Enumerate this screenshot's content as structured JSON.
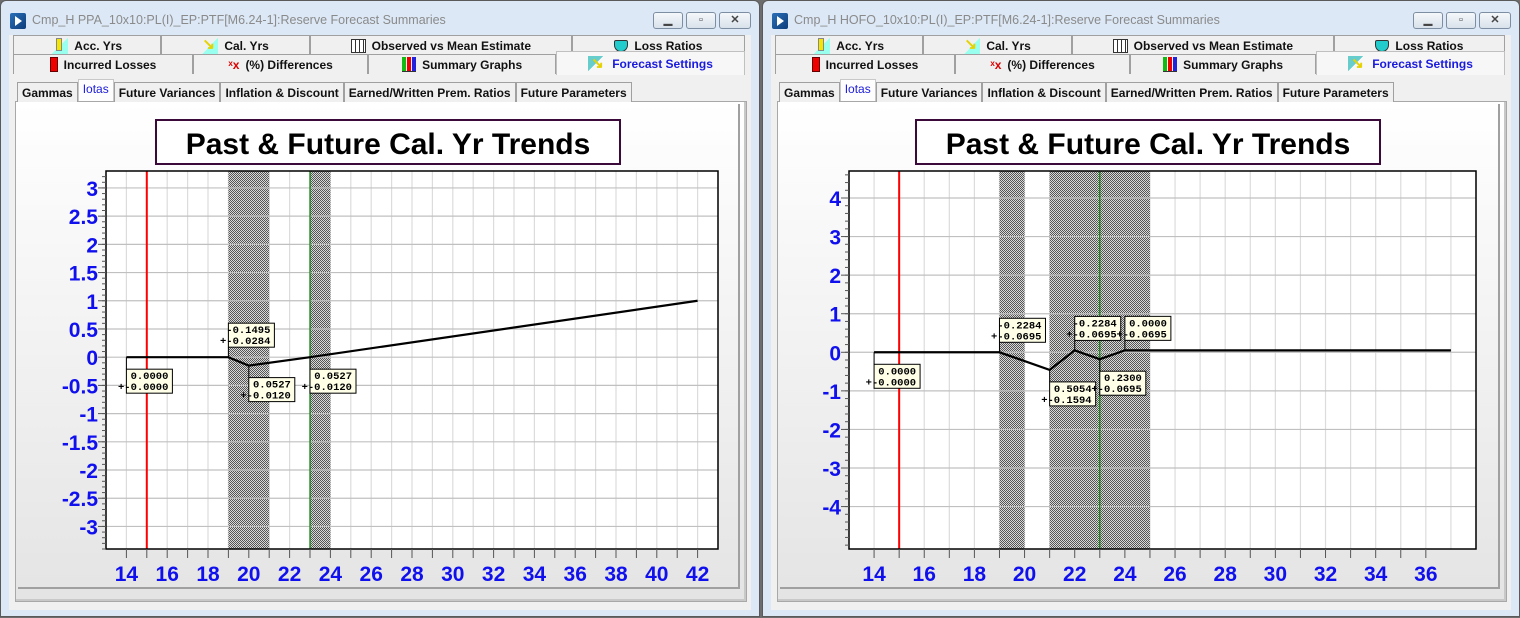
{
  "windows": [
    {
      "title": "Cmp_H PPA_10x10:PL(I)_EP:PTF[M6.24-1]:Reserve Forecast Summaries",
      "window_buttons": {
        "minimize": "minimize-icon",
        "restore": "restore-icon",
        "close": "close-icon"
      },
      "tabs_row1": [
        {
          "label": "Acc. Yrs",
          "icon": "acc-yrs-icon"
        },
        {
          "label": "Cal. Yrs",
          "icon": "cal-yrs-icon"
        },
        {
          "label": "Observed vs Mean Estimate",
          "icon": "table-icon"
        },
        {
          "label": "Loss Ratios",
          "icon": "gauge-icon"
        }
      ],
      "tabs_row2": [
        {
          "label": "Incurred Losses",
          "icon": "red-bar-icon"
        },
        {
          "label": "(%) Differences",
          "icon": "red-x-icon"
        },
        {
          "label": "Summary Graphs",
          "icon": "bar-chart-icon"
        },
        {
          "label": "Forecast Settings",
          "icon": "forecast-icon",
          "active": true
        }
      ],
      "subtabs": [
        {
          "label": "Gammas"
        },
        {
          "label": "Iotas",
          "active": true
        },
        {
          "label": "Future Variances"
        },
        {
          "label": "Inflation & Discount"
        },
        {
          "label": "Earned/Written Prem. Ratios"
        },
        {
          "label": "Future Parameters"
        }
      ],
      "accent_color": "#1a1adf"
    },
    {
      "title": "Cmp_H HOFO_10x10:PL(I)_EP:PTF[M6.24-1]:Reserve Forecast Summaries",
      "window_buttons": {
        "minimize": "minimize-icon",
        "restore": "restore-icon",
        "close": "close-icon"
      },
      "tabs_row1": [
        {
          "label": "Acc. Yrs",
          "icon": "acc-yrs-icon"
        },
        {
          "label": "Cal. Yrs",
          "icon": "cal-yrs-icon"
        },
        {
          "label": "Observed vs Mean Estimate",
          "icon": "table-icon"
        },
        {
          "label": "Loss Ratios",
          "icon": "gauge-icon"
        }
      ],
      "tabs_row2": [
        {
          "label": "Incurred Losses",
          "icon": "red-bar-icon"
        },
        {
          "label": "(%) Differences",
          "icon": "red-x-icon"
        },
        {
          "label": "Summary Graphs",
          "icon": "bar-chart-icon"
        },
        {
          "label": "Forecast Settings",
          "icon": "forecast-icon",
          "active": true
        }
      ],
      "subtabs": [
        {
          "label": "Gammas"
        },
        {
          "label": "Iotas",
          "active": true
        },
        {
          "label": "Future Variances"
        },
        {
          "label": "Inflation & Discount"
        },
        {
          "label": "Earned/Written Prem. Ratios"
        },
        {
          "label": "Future Parameters"
        }
      ],
      "accent_color": "#1a1adf"
    }
  ],
  "chart_data": [
    {
      "type": "line",
      "title": "Past & Future Cal. Yr Trends",
      "xlim": [
        13,
        43
      ],
      "ylim": [
        -3.4,
        3.3
      ],
      "x_ticks": [
        14,
        16,
        18,
        20,
        22,
        24,
        26,
        28,
        30,
        32,
        34,
        36,
        38,
        40,
        42
      ],
      "y_ticks": [
        3,
        2.5,
        2,
        1.5,
        1,
        0.5,
        0,
        -0.5,
        -1,
        -1.5,
        -2,
        -2.5,
        -3
      ],
      "y_tick_labels": [
        "3",
        "2.5",
        "2",
        "1.5",
        "1",
        "0.5",
        "0",
        "-0.5",
        "-1",
        "-1.5",
        "-2",
        "-2.5",
        "-3"
      ],
      "grid": true,
      "series": [
        {
          "name": "cal-yr-trend",
          "color": "#000000",
          "x": [
            14,
            19,
            20,
            23,
            42
          ],
          "y": [
            0,
            0,
            -0.1495,
            0,
            1.0
          ]
        }
      ],
      "vertical_lines": [
        {
          "x": 15,
          "color": "#ff0000"
        },
        {
          "x": 23,
          "color": "#008000"
        }
      ],
      "shaded_bands": [
        [
          19,
          21
        ],
        [
          23,
          24
        ]
      ],
      "annotations": [
        {
          "x": 14,
          "y": 0,
          "trend": "0.0000",
          "stderr": "+-0.0000",
          "position": "below"
        },
        {
          "x": 19,
          "y": 0,
          "trend": "-0.1495",
          "stderr": "+-0.0284",
          "position": "above"
        },
        {
          "x": 20,
          "y": -0.1495,
          "trend": "0.0527",
          "stderr": "+-0.0120",
          "position": "below"
        },
        {
          "x": 23,
          "y": 0,
          "trend": "0.0527",
          "stderr": "+-0.0120",
          "position": "below"
        }
      ],
      "axis_color": "#1010ee"
    },
    {
      "type": "line",
      "title": "Past & Future Cal. Yr Trends",
      "xlim": [
        13,
        38
      ],
      "ylim": [
        -5.1,
        4.7
      ],
      "x_ticks": [
        14,
        16,
        18,
        20,
        22,
        24,
        26,
        28,
        30,
        32,
        34,
        36
      ],
      "y_ticks": [
        4,
        3,
        2,
        1,
        0,
        -1,
        -2,
        -3,
        -4
      ],
      "y_tick_labels": [
        "4",
        "3",
        "2",
        "1",
        "0",
        "-1",
        "-2",
        "-3",
        "-4"
      ],
      "grid": true,
      "series": [
        {
          "name": "cal-yr-trend",
          "color": "#000000",
          "x": [
            14,
            19,
            21,
            22,
            23,
            24,
            37
          ],
          "y": [
            0,
            0,
            -0.4568,
            0.0486,
            -0.1798,
            0.0502,
            0.0502
          ]
        }
      ],
      "vertical_lines": [
        {
          "x": 15,
          "color": "#ff0000"
        },
        {
          "x": 23,
          "color": "#008000"
        }
      ],
      "shaded_bands": [
        [
          19,
          20
        ],
        [
          21,
          25
        ]
      ],
      "annotations": [
        {
          "x": 14,
          "y": 0,
          "trend": "0.0000",
          "stderr": "+-0.0000",
          "position": "below"
        },
        {
          "x": 19,
          "y": 0,
          "trend": "-0.2284",
          "stderr": "+-0.0695",
          "position": "above"
        },
        {
          "x": 21,
          "y": -0.4568,
          "trend": "0.5054",
          "stderr": "+-0.1594",
          "position": "below"
        },
        {
          "x": 22,
          "y": 0.0486,
          "trend": "-0.2284",
          "stderr": "+-0.0695",
          "position": "above"
        },
        {
          "x": 23,
          "y": -0.1798,
          "trend": "0.2300",
          "stderr": "+-0.0695",
          "position": "below"
        },
        {
          "x": 24,
          "y": 0.0502,
          "trend": "0.0000",
          "stderr": "+-0.0695",
          "position": "above"
        }
      ],
      "axis_color": "#1010ee"
    }
  ]
}
